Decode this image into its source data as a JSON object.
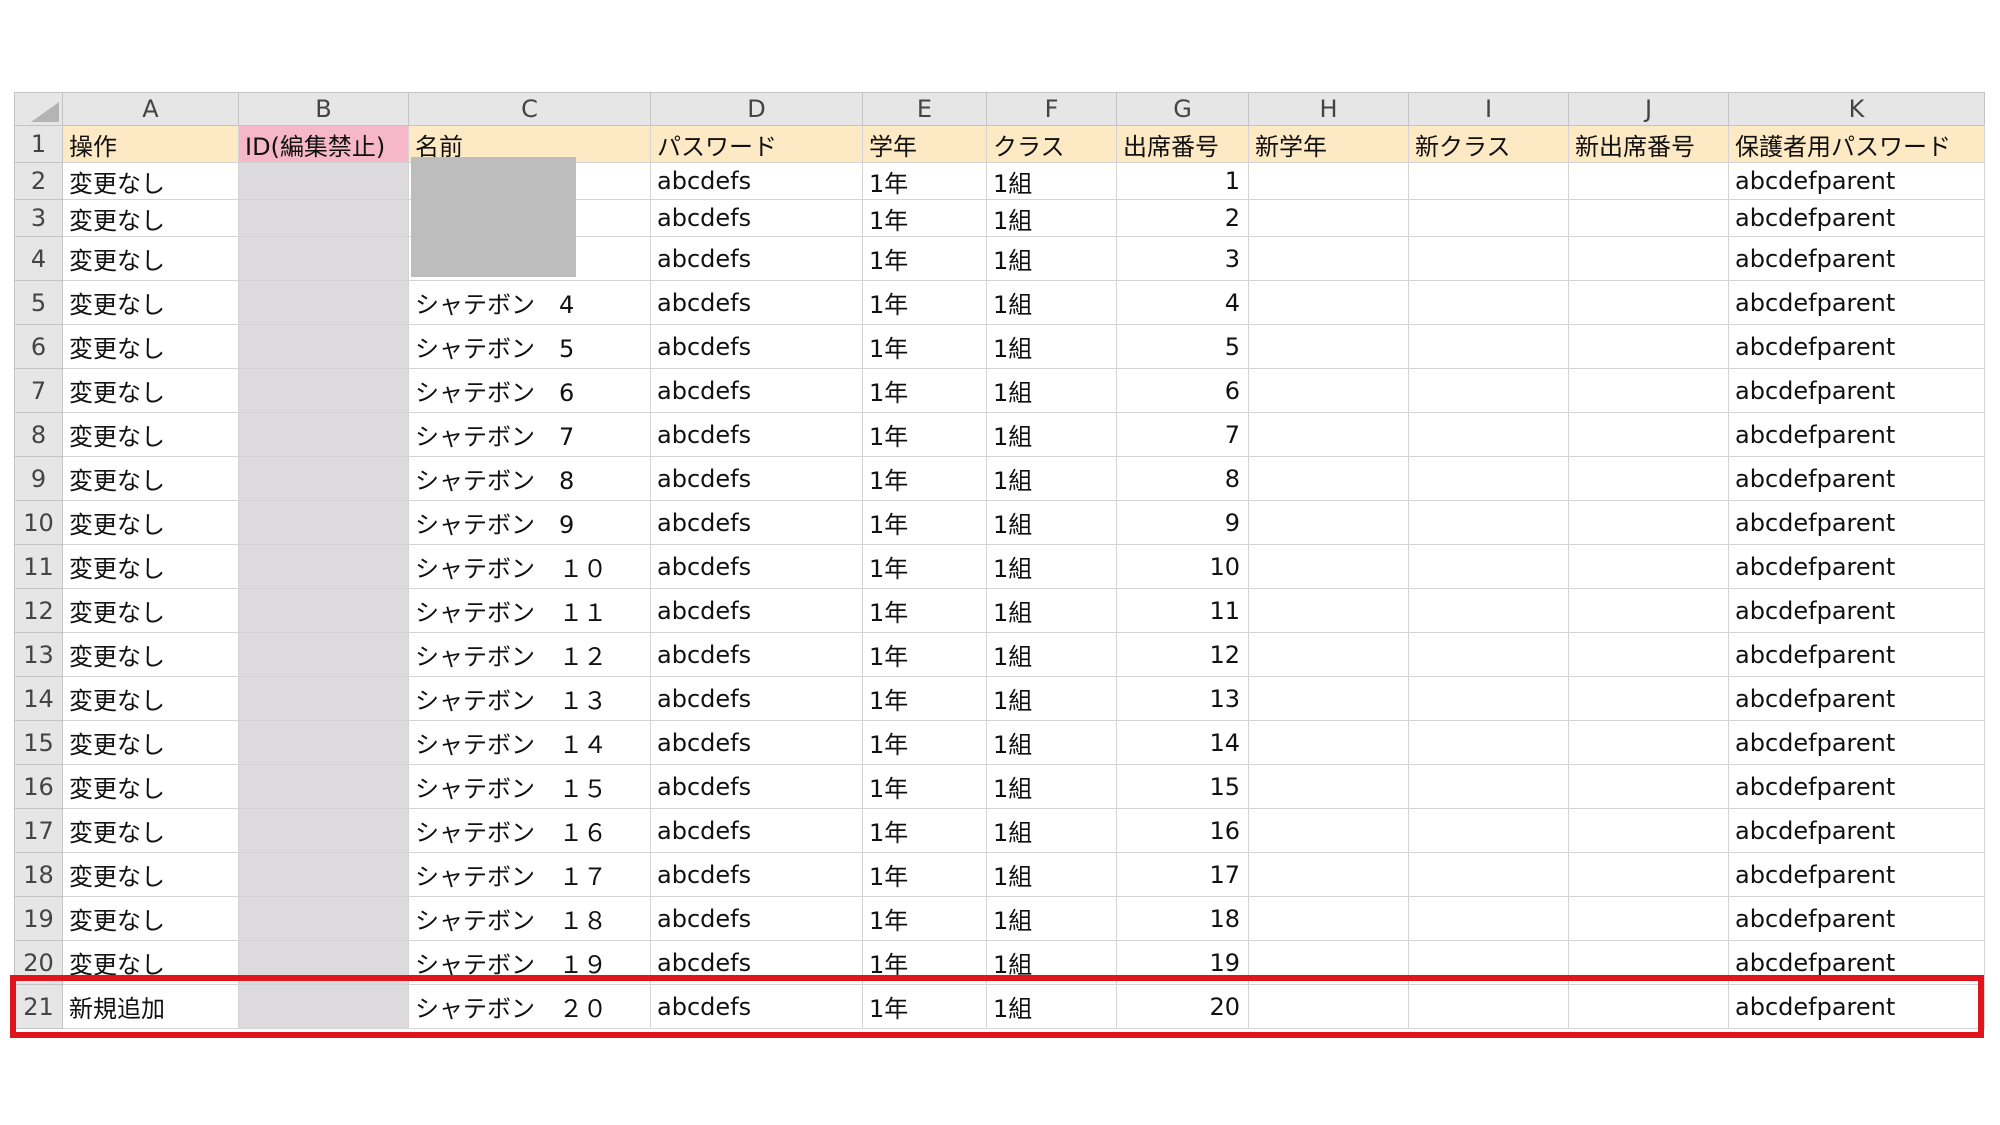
{
  "columns": [
    "A",
    "B",
    "C",
    "D",
    "E",
    "F",
    "G",
    "H",
    "I",
    "J",
    "K"
  ],
  "header_row": {
    "row_number": "1",
    "cells": [
      "操作",
      "ID(編集禁止)",
      "名前",
      "パスワード",
      "学年",
      "クラス",
      "出席番号",
      "新学年",
      "新クラス",
      "新出席番号",
      "保護者用パスワード"
    ]
  },
  "rows": [
    {
      "row_number": "2",
      "op": "変更なし",
      "id": "",
      "name": "",
      "password": "abcdefs",
      "grade": "1年",
      "class": "1組",
      "number": "1",
      "new_grade": "",
      "new_class": "",
      "new_number": "",
      "parent_password": "abcdefparent"
    },
    {
      "row_number": "3",
      "op": "変更なし",
      "id": "",
      "name": "",
      "password": "abcdefs",
      "grade": "1年",
      "class": "1組",
      "number": "2",
      "new_grade": "",
      "new_class": "",
      "new_number": "",
      "parent_password": "abcdefparent"
    },
    {
      "row_number": "4",
      "op": "変更なし",
      "id": "",
      "name": "",
      "password": "abcdefs",
      "grade": "1年",
      "class": "1組",
      "number": "3",
      "new_grade": "",
      "new_class": "",
      "new_number": "",
      "parent_password": "abcdefparent"
    },
    {
      "row_number": "5",
      "op": "変更なし",
      "id": "",
      "name": "シャテボン　4",
      "password": "abcdefs",
      "grade": "1年",
      "class": "1組",
      "number": "4",
      "new_grade": "",
      "new_class": "",
      "new_number": "",
      "parent_password": "abcdefparent"
    },
    {
      "row_number": "6",
      "op": "変更なし",
      "id": "",
      "name": "シャテボン　5",
      "password": "abcdefs",
      "grade": "1年",
      "class": "1組",
      "number": "5",
      "new_grade": "",
      "new_class": "",
      "new_number": "",
      "parent_password": "abcdefparent"
    },
    {
      "row_number": "7",
      "op": "変更なし",
      "id": "",
      "name": "シャテボン　6",
      "password": "abcdefs",
      "grade": "1年",
      "class": "1組",
      "number": "6",
      "new_grade": "",
      "new_class": "",
      "new_number": "",
      "parent_password": "abcdefparent"
    },
    {
      "row_number": "8",
      "op": "変更なし",
      "id": "",
      "name": "シャテボン　7",
      "password": "abcdefs",
      "grade": "1年",
      "class": "1組",
      "number": "7",
      "new_grade": "",
      "new_class": "",
      "new_number": "",
      "parent_password": "abcdefparent"
    },
    {
      "row_number": "9",
      "op": "変更なし",
      "id": "",
      "name": "シャテボン　8",
      "password": "abcdefs",
      "grade": "1年",
      "class": "1組",
      "number": "8",
      "new_grade": "",
      "new_class": "",
      "new_number": "",
      "parent_password": "abcdefparent"
    },
    {
      "row_number": "10",
      "op": "変更なし",
      "id": "",
      "name": "シャテボン　9",
      "password": "abcdefs",
      "grade": "1年",
      "class": "1組",
      "number": "9",
      "new_grade": "",
      "new_class": "",
      "new_number": "",
      "parent_password": "abcdefparent"
    },
    {
      "row_number": "11",
      "op": "変更なし",
      "id": "",
      "name": "シャテボン　１０",
      "password": "abcdefs",
      "grade": "1年",
      "class": "1組",
      "number": "10",
      "new_grade": "",
      "new_class": "",
      "new_number": "",
      "parent_password": "abcdefparent"
    },
    {
      "row_number": "12",
      "op": "変更なし",
      "id": "",
      "name": "シャテボン　１１",
      "password": "abcdefs",
      "grade": "1年",
      "class": "1組",
      "number": "11",
      "new_grade": "",
      "new_class": "",
      "new_number": "",
      "parent_password": "abcdefparent"
    },
    {
      "row_number": "13",
      "op": "変更なし",
      "id": "",
      "name": "シャテボン　１２",
      "password": "abcdefs",
      "grade": "1年",
      "class": "1組",
      "number": "12",
      "new_grade": "",
      "new_class": "",
      "new_number": "",
      "parent_password": "abcdefparent"
    },
    {
      "row_number": "14",
      "op": "変更なし",
      "id": "",
      "name": "シャテボン　１３",
      "password": "abcdefs",
      "grade": "1年",
      "class": "1組",
      "number": "13",
      "new_grade": "",
      "new_class": "",
      "new_number": "",
      "parent_password": "abcdefparent"
    },
    {
      "row_number": "15",
      "op": "変更なし",
      "id": "",
      "name": "シャテボン　１４",
      "password": "abcdefs",
      "grade": "1年",
      "class": "1組",
      "number": "14",
      "new_grade": "",
      "new_class": "",
      "new_number": "",
      "parent_password": "abcdefparent"
    },
    {
      "row_number": "16",
      "op": "変更なし",
      "id": "",
      "name": "シャテボン　１５",
      "password": "abcdefs",
      "grade": "1年",
      "class": "1組",
      "number": "15",
      "new_grade": "",
      "new_class": "",
      "new_number": "",
      "parent_password": "abcdefparent"
    },
    {
      "row_number": "17",
      "op": "変更なし",
      "id": "",
      "name": "シャテボン　１６",
      "password": "abcdefs",
      "grade": "1年",
      "class": "1組",
      "number": "16",
      "new_grade": "",
      "new_class": "",
      "new_number": "",
      "parent_password": "abcdefparent"
    },
    {
      "row_number": "18",
      "op": "変更なし",
      "id": "",
      "name": "シャテボン　１７",
      "password": "abcdefs",
      "grade": "1年",
      "class": "1組",
      "number": "17",
      "new_grade": "",
      "new_class": "",
      "new_number": "",
      "parent_password": "abcdefparent"
    },
    {
      "row_number": "19",
      "op": "変更なし",
      "id": "",
      "name": "シャテボン　１８",
      "password": "abcdefs",
      "grade": "1年",
      "class": "1組",
      "number": "18",
      "new_grade": "",
      "new_class": "",
      "new_number": "",
      "parent_password": "abcdefparent"
    },
    {
      "row_number": "20",
      "op": "変更なし",
      "id": "",
      "name": "シャテボン　１９",
      "password": "abcdefs",
      "grade": "1年",
      "class": "1組",
      "number": "19",
      "new_grade": "",
      "new_class": "",
      "new_number": "",
      "parent_password": "abcdefparent"
    },
    {
      "row_number": "21",
      "op": "新規追加",
      "id": "",
      "name": "シャテボン　２０",
      "password": "abcdefs",
      "grade": "1年",
      "class": "1組",
      "number": "20",
      "new_grade": "",
      "new_class": "",
      "new_number": "",
      "parent_password": "abcdefparent"
    }
  ],
  "colors": {
    "header_fill": "#fde9c4",
    "id_header_fill": "#f6b8c8",
    "id_column_fill": "#dcdadd",
    "highlight": "#e0141c",
    "redaction": "#bdbdbd"
  }
}
